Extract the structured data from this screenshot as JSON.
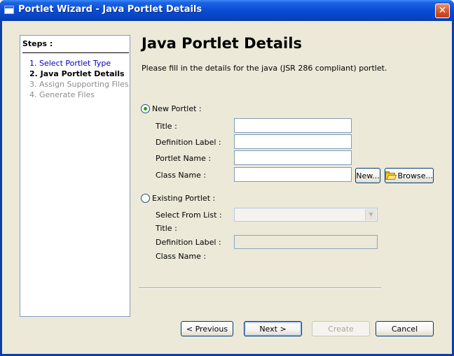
{
  "window": {
    "title": "Portlet Wizard - Java Portlet Details",
    "close_glyph": "✕"
  },
  "steps": {
    "title": "Steps :",
    "items": [
      {
        "label": "1. Select Portlet Type",
        "state": "link"
      },
      {
        "label": "2. Java Portlet Details",
        "state": "current"
      },
      {
        "label": "3. Assign Supporting Files",
        "state": "disabled"
      },
      {
        "label": "4. Generate Files",
        "state": "disabled"
      }
    ]
  },
  "main": {
    "heading": "Java Portlet Details",
    "description": "Please fill in the details for the java (JSR 286 compliant) portlet."
  },
  "new_portlet": {
    "label": "New Portlet :",
    "selected": true,
    "title_label": "Title :",
    "title_value": "",
    "definition_label": "Definition Label :",
    "definition_value": "",
    "portlet_name_label": "Portlet Name :",
    "portlet_name_value": "",
    "class_name_label": "Class Name :",
    "class_name_value": "",
    "new_button": "New...",
    "browse_button": "Browse..."
  },
  "existing_portlet": {
    "label": "Existing Portlet :",
    "selected": false,
    "select_label": "Select From List :",
    "select_value": "",
    "title_label": "Title :",
    "definition_label": "Definition Label :",
    "definition_value": "",
    "class_name_label": "Class Name :"
  },
  "footer": {
    "previous": "< Previous",
    "next": "Next >",
    "create": "Create",
    "cancel": "Cancel"
  },
  "colors": {
    "titlebar": "#0a4fd6",
    "dialog_bg": "#ece9d8",
    "link": "#0000cc",
    "radio_dot": "#21a121"
  }
}
